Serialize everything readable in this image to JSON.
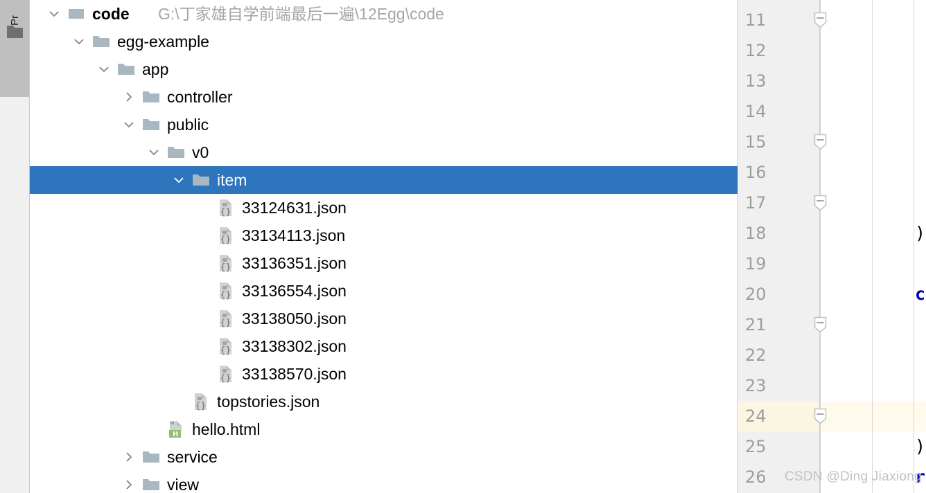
{
  "tool_strip": {
    "tab_label": "Pr",
    "folder_icon": "folder-icon"
  },
  "colors": {
    "selection_blue": "#2d75bd",
    "folder_gray": "#a9b7c0",
    "path_gray": "#a6a6a6",
    "gutter_bg": "#f0f0f0",
    "gutter_text": "#9d9d9d",
    "caret_line": "#fffaec",
    "watermark": "#c2c2c2",
    "code_keyword_blue": "#0000c0",
    "html_badge_green": "#6ea84f"
  },
  "tree": {
    "name": "project-tree",
    "rows": [
      {
        "label": "code",
        "sub": "G:\\丁家雄自学前端最后一遍\\12Egg\\code",
        "indent": 0,
        "arrow": "chevron-down-icon",
        "icon": "module-icon",
        "bold": true,
        "selected": false
      },
      {
        "label": "egg-example",
        "sub": "",
        "indent": 1,
        "arrow": "chevron-down-icon",
        "icon": "folder-icon",
        "bold": false,
        "selected": false
      },
      {
        "label": "app",
        "sub": "",
        "indent": 2,
        "arrow": "chevron-down-icon",
        "icon": "folder-icon",
        "bold": false,
        "selected": false
      },
      {
        "label": "controller",
        "sub": "",
        "indent": 3,
        "arrow": "chevron-right-icon",
        "icon": "folder-icon",
        "bold": false,
        "selected": false
      },
      {
        "label": "public",
        "sub": "",
        "indent": 3,
        "arrow": "chevron-down-icon",
        "icon": "folder-icon",
        "bold": false,
        "selected": false
      },
      {
        "label": "v0",
        "sub": "",
        "indent": 4,
        "arrow": "chevron-down-icon",
        "icon": "folder-icon",
        "bold": false,
        "selected": false
      },
      {
        "label": "item",
        "sub": "",
        "indent": 5,
        "arrow": "chevron-down-icon",
        "icon": "folder-icon",
        "bold": false,
        "selected": true
      },
      {
        "label": "33124631.json",
        "sub": "",
        "indent": 6,
        "arrow": "",
        "icon": "json-file-icon",
        "bold": false,
        "selected": false
      },
      {
        "label": "33134113.json",
        "sub": "",
        "indent": 6,
        "arrow": "",
        "icon": "json-file-icon",
        "bold": false,
        "selected": false
      },
      {
        "label": "33136351.json",
        "sub": "",
        "indent": 6,
        "arrow": "",
        "icon": "json-file-icon",
        "bold": false,
        "selected": false
      },
      {
        "label": "33136554.json",
        "sub": "",
        "indent": 6,
        "arrow": "",
        "icon": "json-file-icon",
        "bold": false,
        "selected": false
      },
      {
        "label": "33138050.json",
        "sub": "",
        "indent": 6,
        "arrow": "",
        "icon": "json-file-icon",
        "bold": false,
        "selected": false
      },
      {
        "label": "33138302.json",
        "sub": "",
        "indent": 6,
        "arrow": "",
        "icon": "json-file-icon",
        "bold": false,
        "selected": false
      },
      {
        "label": "33138570.json",
        "sub": "",
        "indent": 6,
        "arrow": "",
        "icon": "json-file-icon",
        "bold": false,
        "selected": false
      },
      {
        "label": "topstories.json",
        "sub": "",
        "indent": 5,
        "arrow": "",
        "icon": "json-file-icon",
        "bold": false,
        "selected": false
      },
      {
        "label": "hello.html",
        "sub": "",
        "indent": 4,
        "arrow": "",
        "icon": "html-file-icon",
        "bold": false,
        "selected": false
      },
      {
        "label": "service",
        "sub": "",
        "indent": 3,
        "arrow": "chevron-right-icon",
        "icon": "folder-icon",
        "bold": false,
        "selected": false
      },
      {
        "label": "view",
        "sub": "",
        "indent": 3,
        "arrow": "chevron-right-icon",
        "icon": "folder-icon",
        "bold": false,
        "selected": false
      }
    ]
  },
  "editor": {
    "name": "code-editor",
    "line_numbers": [
      "11",
      "12",
      "13",
      "14",
      "15",
      "16",
      "17",
      "18",
      "19",
      "20",
      "21",
      "22",
      "23",
      "24",
      "25",
      "26"
    ],
    "caret_line_number": "24",
    "fold_markers": [
      {
        "line": "11",
        "type": "fold-collapse-icon"
      },
      {
        "line": "15",
        "type": "fold-collapse-icon"
      },
      {
        "line": "17",
        "type": "fold-collapse-icon"
      },
      {
        "line": "21",
        "type": "fold-collapse-icon"
      },
      {
        "line": "24",
        "type": "fold-collapse-icon"
      }
    ],
    "code_fragments": [
      {
        "line": "18",
        "text": ")",
        "color": "#000000",
        "bold": false
      },
      {
        "line": "20",
        "text": "c",
        "color": "#0000c0",
        "bold": true
      },
      {
        "line": "25",
        "text": ")",
        "color": "#000000",
        "bold": false
      },
      {
        "line": "26",
        "text": "r",
        "color": "#0000c0",
        "bold": true
      }
    ]
  },
  "watermark": {
    "text": "CSDN @Ding Jiaxiong"
  }
}
